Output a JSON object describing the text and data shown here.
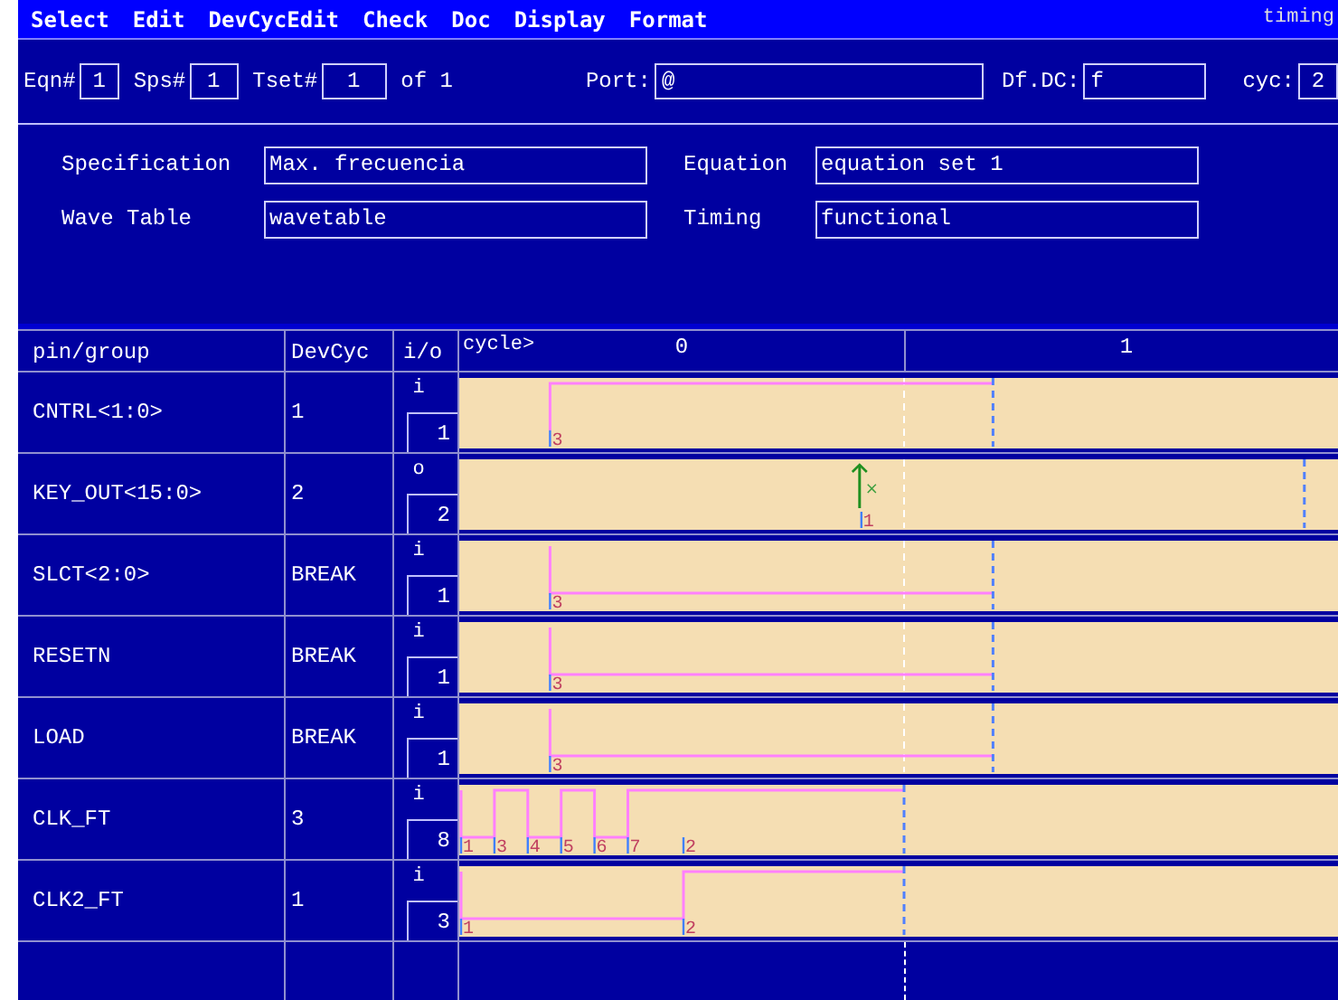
{
  "menu": [
    "Select",
    "Edit",
    "DevCycEdit",
    "Check",
    "Doc",
    "Display",
    "Format"
  ],
  "window_title": "timing",
  "toolbar": [
    {
      "label": "Eqn#",
      "value": "1"
    },
    {
      "label": "Sps#",
      "value": "1"
    },
    {
      "label": "Tset#",
      "value": "1",
      "suffix": "of 1"
    },
    {
      "label": "Port:",
      "value": "@"
    },
    {
      "label": "Df.DC:",
      "value": "f"
    },
    {
      "label": "cyc:",
      "value": "2"
    }
  ],
  "form": [
    {
      "label": "Specification",
      "value": "Max. frecuencia"
    },
    {
      "label": "Equation",
      "value": "equation set 1"
    },
    {
      "label": "Wave Table",
      "value": "wavetable"
    },
    {
      "label": "Timing",
      "value": "functional"
    }
  ],
  "table": {
    "columns": [
      "pin/group",
      "DevCyc",
      "i/o"
    ],
    "cycle_label": "cycle>",
    "cycles": [
      "0",
      "1"
    ],
    "rows": [
      {
        "pin": "CNTRL<1:0>",
        "devcyc": "1",
        "io": "i",
        "count": "1",
        "wave": {
          "kind": "drive",
          "edges": [
            "3"
          ]
        }
      },
      {
        "pin": "KEY_OUT<15:0>",
        "devcyc": "2",
        "io": "o",
        "count": "2",
        "wave": {
          "kind": "compare",
          "mark": "×",
          "edges": [
            "1"
          ]
        }
      },
      {
        "pin": "SLCT<2:0>",
        "devcyc": "BREAK",
        "io": "i",
        "count": "1",
        "wave": {
          "kind": "drive",
          "edges": [
            "3"
          ]
        }
      },
      {
        "pin": "RESETN",
        "devcyc": "BREAK",
        "io": "i",
        "count": "1",
        "wave": {
          "kind": "drive",
          "edges": [
            "3"
          ]
        }
      },
      {
        "pin": "LOAD",
        "devcyc": "BREAK",
        "io": "i",
        "count": "1",
        "wave": {
          "kind": "drive",
          "edges": [
            "3"
          ]
        }
      },
      {
        "pin": "CLK_FT",
        "devcyc": "3",
        "io": "i",
        "count": "8",
        "wave": {
          "kind": "drive",
          "edges": [
            "1",
            "3",
            "4",
            "5",
            "6",
            "7",
            "2"
          ]
        }
      },
      {
        "pin": "CLK2_FT",
        "devcyc": "1",
        "io": "i",
        "count": "3",
        "wave": {
          "kind": "drive",
          "edges": [
            "1",
            "2"
          ]
        }
      }
    ]
  }
}
